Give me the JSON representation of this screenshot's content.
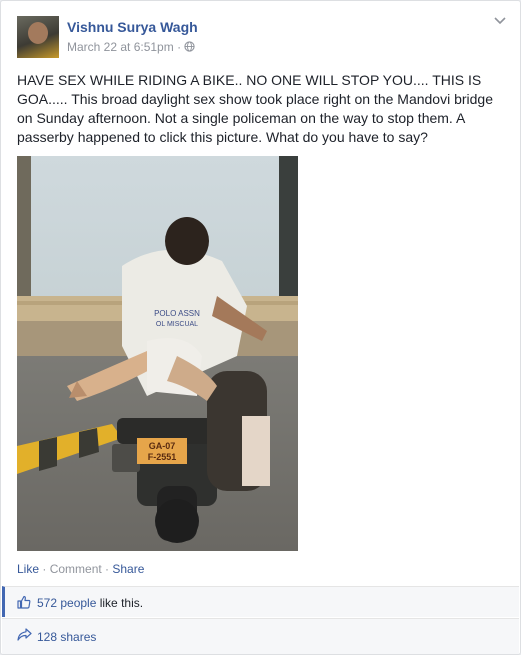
{
  "post": {
    "author": "Vishnu Surya Wagh",
    "date": "March 22 at 6:51pm",
    "meta_sep": "·",
    "body": "HAVE SEX WHILE RIDING A BIKE.. NO ONE WILL STOP YOU.... THIS IS GOA..... This broad daylight sex show took place right on the Mandovi bridge on Sunday afternoon. Not a single policeman on the way to stop them. A passerby happened to click this picture. What do you have to say?",
    "plate_line1": "GA-07",
    "plate_line2": "F-2551",
    "shirt_line1": "POLO ASSN",
    "shirt_line2": "OL MISCUAL"
  },
  "actions": {
    "like": "Like",
    "sep1": " · ",
    "comment": "Comment",
    "sep2": " · ",
    "share": "Share"
  },
  "likes": {
    "count": "572 people",
    "suffix": " like this."
  },
  "shares": {
    "label": "128 shares"
  },
  "icons": [
    "globe-icon",
    "chevron-down-icon",
    "thumbs-up-icon",
    "share-arrow-icon"
  ]
}
